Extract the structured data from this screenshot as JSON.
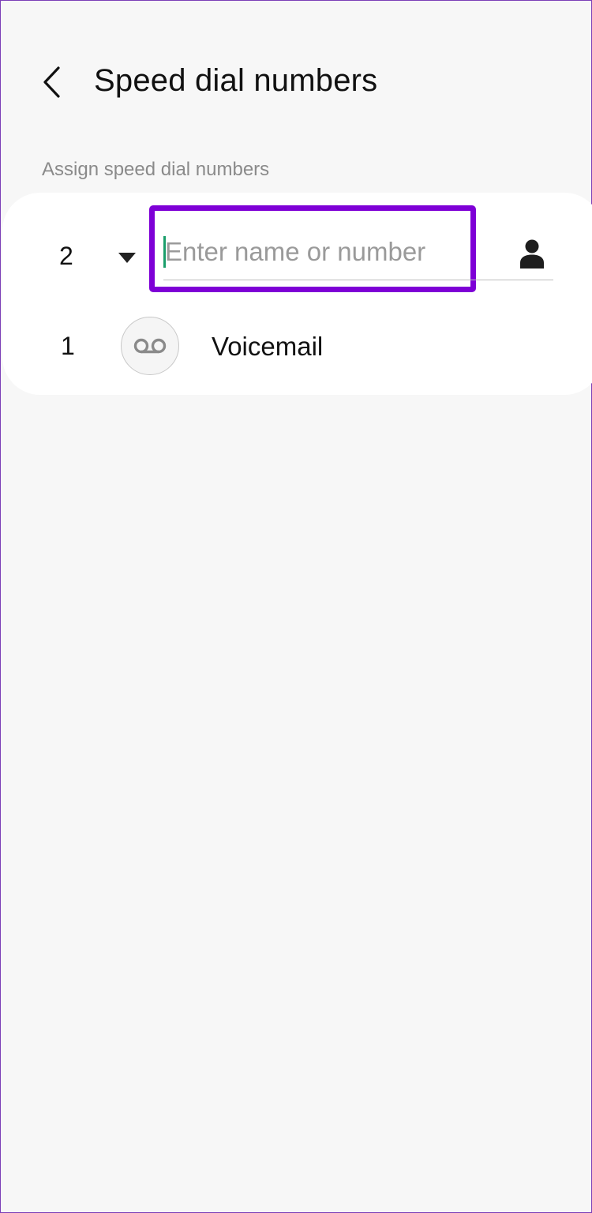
{
  "header": {
    "title": "Speed dial numbers",
    "back_icon": "chevron-left-icon"
  },
  "section": {
    "label": "Assign speed dial numbers"
  },
  "assign_row": {
    "digit": "2",
    "dropdown_icon": "caret-down-icon",
    "input": {
      "placeholder": "Enter name or number",
      "value": ""
    },
    "contact_icon": "person-icon"
  },
  "voicemail_row": {
    "digit": "1",
    "icon": "voicemail-icon",
    "label": "Voicemail"
  },
  "colors": {
    "background": "#f7f7f7",
    "card": "#ffffff",
    "highlight": "#7e00d6",
    "cursor": "#1a9e6b",
    "placeholder": "#9a9a9a"
  }
}
